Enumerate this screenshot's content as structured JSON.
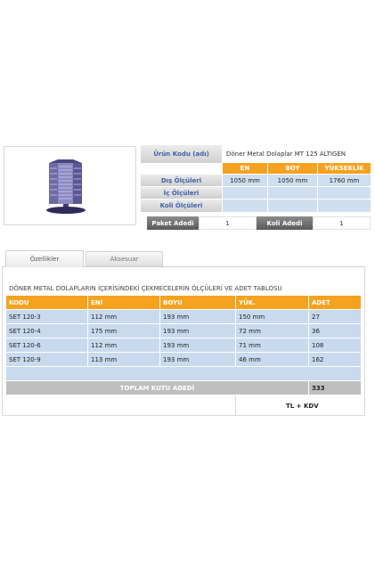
{
  "product": {
    "image_icon": "rotating-cabinet-image"
  },
  "spec": {
    "product_code_label": "Ürün Kodu (adı)",
    "product_code_value": "Döner Metal Dolaplar MT 125 ALTIGEN",
    "headers": {
      "en": "EN",
      "boy": "BOY",
      "yukseklik": "YÜKSEKLİK"
    },
    "rows": [
      {
        "label": "Dış Ölçüleri",
        "en": "1050 mm",
        "boy": "1050 mm",
        "yukseklik": "1760 mm"
      },
      {
        "label": "İç Ölçüleri",
        "en": "",
        "boy": "",
        "yukseklik": ""
      },
      {
        "label": "Koli Ölçüleri",
        "en": "",
        "boy": "",
        "yukseklik": ""
      }
    ],
    "paket_label": "Paket Adedi",
    "paket_value": "1",
    "koli_label": "Koli Adedi",
    "koli_value": "1"
  },
  "tabs": [
    {
      "label": "Özellikler",
      "active": true
    },
    {
      "label": "Aksesuar",
      "active": false
    }
  ],
  "drawer_table": {
    "title": "DÖNER METAL DOLAPLARIN İÇERİSİNDEKİ ÇEKMECELERİN ÖLÇÜLERİ VE ADET TABLOSU",
    "columns": [
      "KODU",
      "ENİ",
      "BOYU",
      "YÜK.",
      "ADET"
    ],
    "rows": [
      [
        "SET 120-3",
        "112 mm",
        "193 mm",
        "150 mm",
        "27"
      ],
      [
        "SET 120-4",
        "175 mm",
        "193 mm",
        "72 mm",
        "36"
      ],
      [
        "SET 120-6",
        "112 mm",
        "193 mm",
        "71 mm",
        "108"
      ],
      [
        "SET 120-9",
        "113 mm",
        "193 mm",
        "46 mm",
        "162"
      ]
    ],
    "total_label": "TOPLAM KUTU ADEDİ",
    "total_value": "333",
    "price_note": "TL + KDV"
  },
  "colors": {
    "orange": "#f4a21f",
    "light_blue": "#c9daee",
    "label_blue_text": "#3c62a8",
    "total_gray": "#bfbfbf"
  }
}
